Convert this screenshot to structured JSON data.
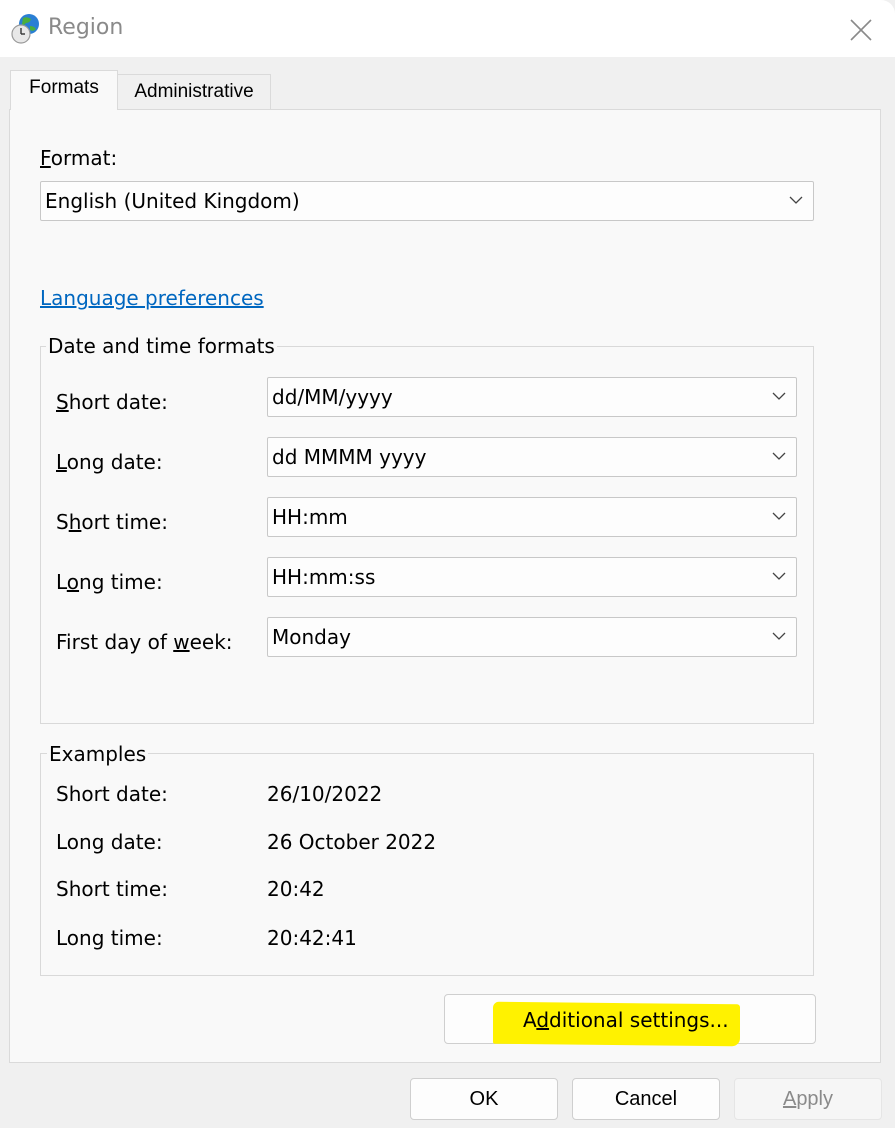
{
  "window": {
    "title": "Region",
    "icon": "globe-clock-icon",
    "close_icon": "close-icon"
  },
  "tabs": [
    {
      "label": "Formats",
      "active": true
    },
    {
      "label": "Administrative",
      "active": false
    }
  ],
  "format": {
    "label_pre": "",
    "label_accel": "F",
    "label_post": "ormat:",
    "value": "English (United Kingdom)"
  },
  "language_link": "Language preferences",
  "date_time_formats": {
    "title": "Date and time formats",
    "rows": [
      {
        "pre": "",
        "accel": "S",
        "post": "hort date:",
        "value": "dd/MM/yyyy"
      },
      {
        "pre": "",
        "accel": "L",
        "post": "ong date:",
        "value": "dd MMMM yyyy"
      },
      {
        "pre": "S",
        "accel": "h",
        "post": "ort time:",
        "value": "HH:mm"
      },
      {
        "pre": "L",
        "accel": "o",
        "post": "ng time:",
        "value": "HH:mm:ss"
      },
      {
        "pre": "First day of ",
        "accel": "w",
        "post": "eek:",
        "value": "Monday"
      }
    ]
  },
  "examples": {
    "title": "Examples",
    "rows": [
      {
        "label": "Short date:",
        "value": "26/10/2022"
      },
      {
        "label": "Long date:",
        "value": "26 October 2022"
      },
      {
        "label": "Short time:",
        "value": "20:42"
      },
      {
        "label": "Long time:",
        "value": "20:42:41"
      }
    ]
  },
  "additional_settings": {
    "pre": "A",
    "accel": "d",
    "post": "ditional settings...",
    "highlight_color": "#fff200"
  },
  "footer": {
    "ok": "OK",
    "cancel": "Cancel",
    "apply_accel": "A",
    "apply_post": "pply",
    "apply_enabled": false
  }
}
